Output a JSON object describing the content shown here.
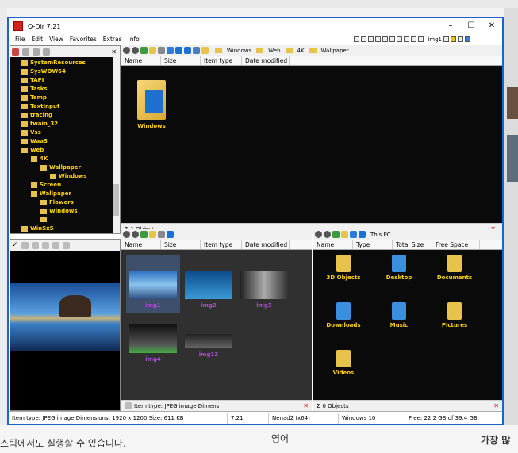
{
  "window": {
    "title": "Q-Dir 7.21"
  },
  "menu": [
    "File",
    "Edit",
    "View",
    "Favorites",
    "Extras",
    "Info"
  ],
  "quick_label": "img1",
  "tree": {
    "items": [
      "SystemResources",
      "SysWOW64",
      "TAPI",
      "Tasks",
      "Temp",
      "TextInput",
      "tracing",
      "twain_32",
      "Vss",
      "WaaS",
      "Web",
      "4K",
      "Wallpaper",
      "Windows",
      "Screen",
      "Wallpaper",
      "Flowers",
      "Windows",
      "WinSxS"
    ]
  },
  "pane1": {
    "crumbs": [
      "Windows",
      "Web",
      "4K",
      "Wallpaper"
    ],
    "headers": [
      "Name",
      "Size",
      "Item type",
      "Date modified"
    ],
    "items": [
      "Windows"
    ],
    "status": "1 Object"
  },
  "pane2": {
    "headers": [
      "Name",
      "Size",
      "Item type",
      "Date modified"
    ],
    "items": [
      "img1",
      "img2",
      "img3",
      "img4",
      "img13"
    ],
    "status": "Item type: JPEG image Dimens"
  },
  "pane3": {
    "location": "This PC",
    "headers": [
      "Name",
      "Type",
      "Total Size",
      "Free Space"
    ],
    "items": [
      "3D Objects",
      "Desktop",
      "Documents",
      "Downloads",
      "Music",
      "Pictures",
      "Videos"
    ],
    "status": "0 Objects"
  },
  "statusbar": {
    "info": "Item type: JPEG image Dimensions: 1920 x 1200 Size: 611 KB",
    "version": "7.21",
    "user": "Nenad2 (x64)",
    "os": "Windows 10",
    "free": "Free: 22.2 GB of 39.4 GB"
  },
  "background": {
    "text1": "스틱에서도 실행할 수 있습니다.",
    "text2": "영어",
    "text3": "가장 많"
  }
}
